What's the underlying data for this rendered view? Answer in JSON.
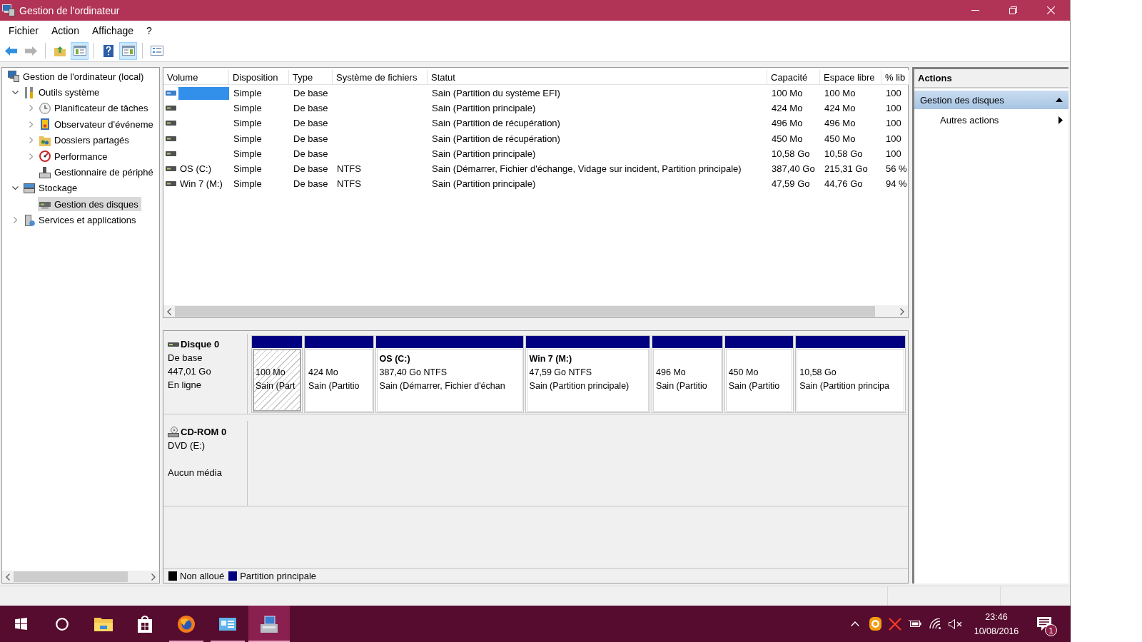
{
  "window": {
    "title": "Gestion de l'ordinateur"
  },
  "menu": [
    "Fichier",
    "Action",
    "Affichage",
    "?"
  ],
  "toolbar": [
    {
      "kind": "back",
      "pressed": false,
      "disabled": false
    },
    {
      "kind": "forward",
      "pressed": false,
      "disabled": true
    },
    {
      "kind": "up",
      "pressed": false,
      "disabled": false
    },
    {
      "kind": "tree",
      "pressed": true,
      "disabled": false
    },
    {
      "kind": "help",
      "pressed": false,
      "disabled": false
    },
    {
      "kind": "pane",
      "pressed": true,
      "disabled": false
    },
    {
      "kind": "properties",
      "pressed": false,
      "disabled": false
    }
  ],
  "tree": [
    {
      "label": "Gestion de l'ordinateur (local)",
      "kind": "computer",
      "selected": false,
      "children": [
        {
          "label": "Outils système",
          "kind": "tools",
          "expanded": true,
          "selected": false,
          "children": [
            {
              "label": "Planificateur de tâches",
              "kind": "scheduler",
              "expanded": false,
              "selected": false
            },
            {
              "label": "Observateur d’événeme",
              "kind": "events",
              "expanded": false,
              "selected": false
            },
            {
              "label": "Dossiers partagés",
              "kind": "shares",
              "expanded": false,
              "selected": false
            },
            {
              "label": "Performance",
              "kind": "performance",
              "expanded": false,
              "selected": false
            },
            {
              "label": "Gestionnaire de périphé",
              "kind": "devices",
              "selected": false
            }
          ]
        },
        {
          "label": "Stockage",
          "kind": "storage",
          "expanded": true,
          "selected": false,
          "children": [
            {
              "label": "Gestion des disques",
              "kind": "disks",
              "selected": true
            }
          ]
        },
        {
          "label": "Services et applications",
          "kind": "services",
          "expanded": false,
          "selected": false
        }
      ]
    }
  ],
  "volumes": {
    "columns": [
      "Volume",
      "Disposition",
      "Type",
      "Système de fichiers",
      "Statut",
      "Capacité",
      "Espace libre",
      "% lib"
    ],
    "rows": [
      {
        "selected": true,
        "layout": "Simple",
        "type": "De base",
        "status": "Sain (Partition du système EFI)",
        "capacity": "100 Mo",
        "free_space": "100 Mo",
        "column_8": "100"
      },
      {
        "selected": false,
        "layout": "Simple",
        "type": "De base",
        "status": "Sain (Partition principale)",
        "capacity": "424 Mo",
        "free_space": "424 Mo",
        "column_8": "100"
      },
      {
        "selected": false,
        "layout": "Simple",
        "type": "De base",
        "status": "Sain (Partition de récupération)",
        "capacity": "496 Mo",
        "free_space": "496 Mo",
        "column_8": "100"
      },
      {
        "selected": false,
        "layout": "Simple",
        "type": "De base",
        "status": "Sain (Partition de récupération)",
        "capacity": "450 Mo",
        "free_space": "450 Mo",
        "column_8": "100"
      },
      {
        "selected": false,
        "layout": "Simple",
        "type": "De base",
        "status": "Sain (Partition principale)",
        "capacity": "10,58 Go",
        "free_space": "10,58 Go",
        "column_8": "100"
      },
      {
        "selected": false,
        "volume": "OS (C:)",
        "layout": "Simple",
        "type": "De base",
        "file_system": "NTFS",
        "status": "Sain (Démarrer, Fichier d'échange, Vidage sur incident, Partition principale)",
        "capacity": "387,40 Go",
        "free_space": "215,31 Go",
        "column_8": "56 %"
      },
      {
        "selected": false,
        "volume": "Win 7 (M:)",
        "layout": "Simple",
        "type": "De base",
        "file_system": "NTFS",
        "status": "Sain (Partition principale)",
        "capacity": "47,59 Go",
        "free_space": "44,76 Go",
        "column_8": "94 %"
      }
    ]
  },
  "disk_map": {
    "disks": [
      {
        "kind": "disk",
        "name": "Disque 0",
        "type": "De base",
        "size": "447,01 Go",
        "status": "En ligne",
        "partitions": [
          {
            "size": "100 Mo",
            "status": "Sain (Part",
            "kind": "primary",
            "selected": true
          },
          {
            "size": "424 Mo",
            "status": "Sain (Partitio",
            "kind": "primary",
            "selected": false
          },
          {
            "name": "OS (C:)",
            "size": "387,40 Go NTFS",
            "status": "Sain (Démarrer, Fichier d'échan",
            "kind": "primary",
            "selected": false
          },
          {
            "name": "Win 7 (M:)",
            "size": "47,59 Go NTFS",
            "status": "Sain (Partition principale)",
            "kind": "primary",
            "selected": false
          },
          {
            "size": "496 Mo",
            "status": "Sain (Partitio",
            "kind": "primary",
            "selected": false
          },
          {
            "size": "450 Mo",
            "status": "Sain (Partitio",
            "kind": "primary",
            "selected": false
          },
          {
            "size": "10,58 Go",
            "status": "Sain (Partition principa",
            "kind": "primary",
            "selected": false
          }
        ]
      },
      {
        "kind": "cdrom",
        "name": "CD-ROM 0",
        "type": "DVD (E:)",
        "status": "Aucun média"
      }
    ],
    "legend": [
      {
        "label": "Non alloué",
        "kind": "unallocated",
        "color": "#000000"
      },
      {
        "label": "Partition principale",
        "kind": "primary",
        "color": "#000080"
      }
    ]
  },
  "actions": {
    "title": "Actions",
    "sections": [
      {
        "label": "Gestion des disques",
        "expanded": true,
        "items": [
          {
            "label": "Autres actions",
            "submenu": true
          }
        ]
      }
    ]
  },
  "taskbar": {
    "items": [
      {
        "kind": "start",
        "running": false,
        "active": false
      },
      {
        "kind": "search",
        "running": false,
        "active": false
      },
      {
        "kind": "explorer",
        "running": false,
        "active": false
      },
      {
        "kind": "store",
        "running": false,
        "active": false
      },
      {
        "kind": "browser",
        "running": true,
        "active": false
      },
      {
        "kind": "panel",
        "running": true,
        "active": false
      },
      {
        "kind": "manager",
        "running": true,
        "active": true
      }
    ],
    "tray": {
      "muted": true
    },
    "clock": {
      "time": "23:46",
      "date": "10/08/2016"
    },
    "notifications": {
      "count": "1"
    }
  }
}
